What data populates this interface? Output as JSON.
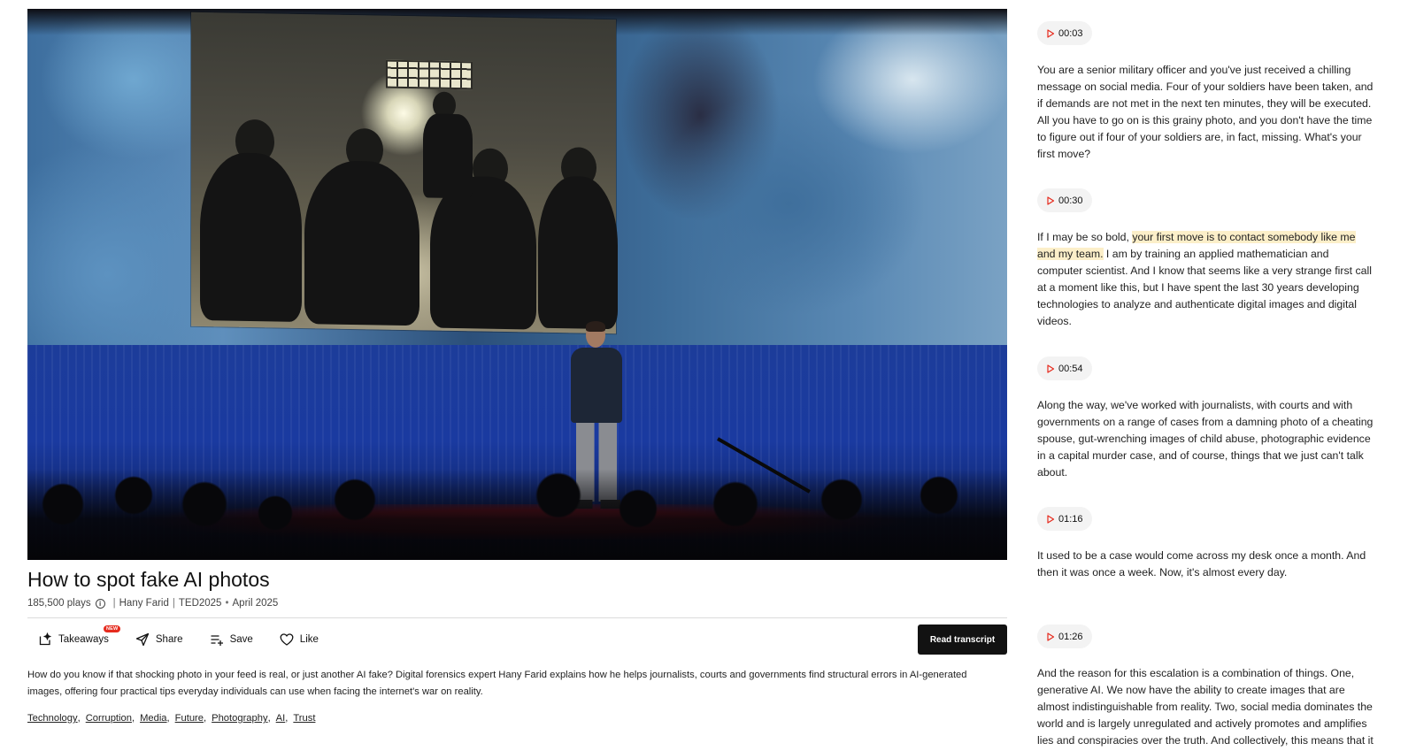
{
  "talk": {
    "title": "How to spot fake AI photos",
    "plays": "185,500 plays",
    "speaker": "Hany Farid",
    "event": "TED2025",
    "date_sep": "•",
    "date": "April 2025",
    "description": "How do you know if that shocking photo in your feed is real, or just another AI fake? Digital forensics expert Hany Farid explains how he helps journalists, courts and governments find structural errors in AI-generated images, offering four practical tips everyday individuals can use when facing the internet's war on reality.",
    "tags": [
      "Technology",
      "Corruption",
      "Media",
      "Future",
      "Photography",
      "AI",
      "Trust"
    ]
  },
  "actions": {
    "takeaways": "Takeaways",
    "new_badge": "NEW",
    "share": "Share",
    "save": "Save",
    "like": "Like",
    "read_transcript": "Read transcript"
  },
  "icons": {
    "play": "play-icon",
    "takeaways": "sparkle-icon",
    "share": "send-icon",
    "save": "playlist-add-icon",
    "like": "heart-icon",
    "info": "info-icon"
  },
  "colors": {
    "accent": "#e62b1e",
    "highlight": "#fcefc9",
    "button": "#121212"
  },
  "transcript": [
    {
      "time": "00:03",
      "text": "You are a senior military officer and you've just received a chilling message on social media. Four of your soldiers have been taken, and if demands are not met in the next ten minutes, they will be executed. All you have to go on is this grainy photo, and you don't have the time to figure out if four of your soldiers are, in fact, missing. What's your first move?"
    },
    {
      "time": "00:30",
      "text_before": "If I may be so bold, ",
      "highlight": "your first move is to contact somebody like me and my team.",
      "text_after": " I am by training an applied mathematician and computer scientist. And I know that seems like a very strange first call at a moment like this, but I have spent the last 30 years developing technologies to analyze and authenticate digital images and digital videos."
    },
    {
      "time": "00:54",
      "text": "Along the way, we've worked with journalists, with courts and with governments on a range of cases from a damning photo of a cheating spouse, gut-wrenching images of child abuse, photographic evidence in a capital murder case, and of course, things that we just can't talk about."
    },
    {
      "time": "01:16",
      "text": "It used to be a case would come across my desk once a month. And then it was once a week. Now, it's almost every day."
    },
    {
      "time": "01:26",
      "text": "And the reason for this escalation is a combination of things. One, generative AI. We now have the ability to create images that are almost indistinguishable from reality. Two, social media dominates the world and is largely unregulated and actively promotes and amplifies lies and conspiracies over the truth. And collectively, this means that it is becoming harder and harder to believe what we read, see and hear online."
    }
  ]
}
